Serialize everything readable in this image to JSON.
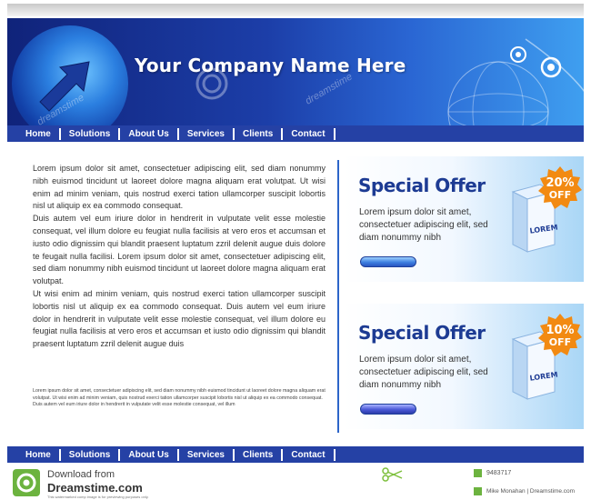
{
  "header": {
    "company_name": "Your Company Name Here",
    "watermark": "dreamstime"
  },
  "nav": {
    "items": [
      "Home",
      "Solutions",
      "About Us",
      "Services",
      "Clients",
      "Contact"
    ]
  },
  "content": {
    "paragraphs": [
      "Lorem ipsum dolor sit amet, consectetuer adipiscing elit, sed diam nonummy nibh euismod tincidunt ut laoreet dolore magna aliquam erat volutpat. Ut wisi enim ad minim veniam, quis nostrud exerci tation ullamcorper suscipit lobortis nisl ut aliquip ex ea commodo consequat.",
      "Duis autem vel eum iriure dolor in hendrerit in vulputate velit esse molestie consequat, vel illum dolore eu feugiat nulla facilisis at vero eros et accumsan et iusto odio dignissim qui blandit praesent luptatum zzril delenit augue duis dolore te feugait nulla facilisi. Lorem ipsum dolor sit amet, consectetuer adipiscing elit, sed diam nonummy nibh euismod tincidunt ut laoreet dolore magna aliquam erat volutpat.",
      "Ut wisi enim ad minim veniam, quis nostrud exerci tation ullamcorper suscipit lobortis nisl ut aliquip ex ea commodo consequat. Duis autem vel eum iriure dolor in hendrerit in vulputate velit esse molestie consequat, vel illum dolore eu feugiat nulla facilisis at vero eros et accumsan et iusto odio dignissim qui blandit praesent luptatum zzril delenit augue duis"
    ],
    "small_paragraphs": [
      "Lorem ipsum dolor sit amet, consectetuer adipiscing elit, sed diam nonummy nibh euismod tincidunt ut laoreet dolore magna aliquam erat volutpat. Ut wisi enim ad minim veniam, quis nostrud exerci tation ullamcorper suscipit lobortis nisl ut aliquip ex ea commodo consequat.",
      "Duis autem vel eum iriure dolor in hendrerit in vulputate velit esse molestie consequat, vel illum"
    ]
  },
  "offers": [
    {
      "title": "Special Offer",
      "description": "Lorem ipsum dolor sit amet, consectetuer adipiscing elit, sed diam nonummy nibh",
      "badge_percent": "20%",
      "badge_label": "OFF",
      "box_label": "LOREM"
    },
    {
      "title": "Special Offer",
      "description": "Lorem ipsum dolor sit amet, consectetuer adipiscing elit, sed diam nonummy nibh",
      "badge_percent": "10%",
      "badge_label": "OFF",
      "box_label": "LOREM"
    }
  ],
  "footer": {
    "download_text": "Download from",
    "brand": "Dreamstime.com",
    "small_note": "This watermarked comp image is for previewing purposes only.",
    "image_id": "9483717",
    "author": "Mike Monahan | Dreamstime.com"
  },
  "colors": {
    "nav_bg": "#2541a5",
    "title_blue": "#1d3b93",
    "badge_orange": "#f28a12"
  }
}
